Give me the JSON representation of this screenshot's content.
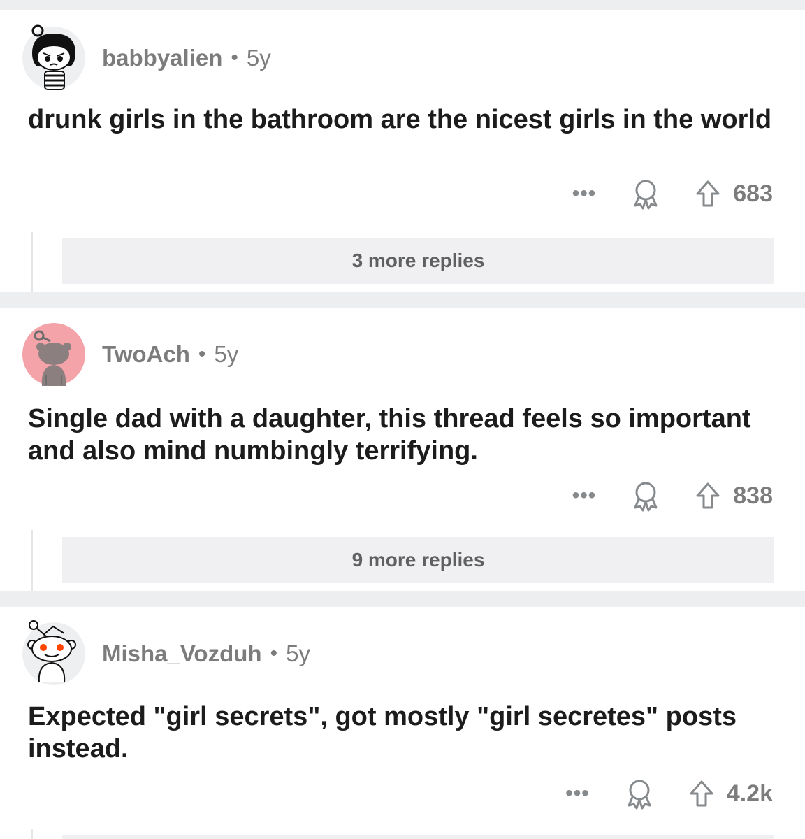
{
  "comments": [
    {
      "username": "babbyalien",
      "separator": "•",
      "age": "5y",
      "text": "drunk girls in the bathroom are the nicest girls in the world",
      "more_icon": "•••",
      "score": "683",
      "more_replies": "3 more replies",
      "avatar": "snoo-striped-shirt-avatar"
    },
    {
      "username": "TwoAch",
      "separator": "•",
      "age": "5y",
      "text": "Single dad with a daughter, this thread feels so important and also mind numbingly terrifying.",
      "more_icon": "•••",
      "score": "838",
      "more_replies": "9 more replies",
      "avatar": "snoo-pink-silhouette-avatar"
    },
    {
      "username": "Misha_Vozduh",
      "separator": "•",
      "age": "5y",
      "text": "Expected \"girl secrets\", got mostly \"girl secretes\" posts instead.",
      "more_icon": "•••",
      "score": "4.2k",
      "avatar": "snoo-default-avatar"
    }
  ],
  "colors": {
    "divider": "#edeef0",
    "meta_text": "#7c7c7c",
    "body_text": "#1c1c1c",
    "more_replies_bg": "#f0f0f2",
    "avatar_pink": "#f4a3a9"
  }
}
